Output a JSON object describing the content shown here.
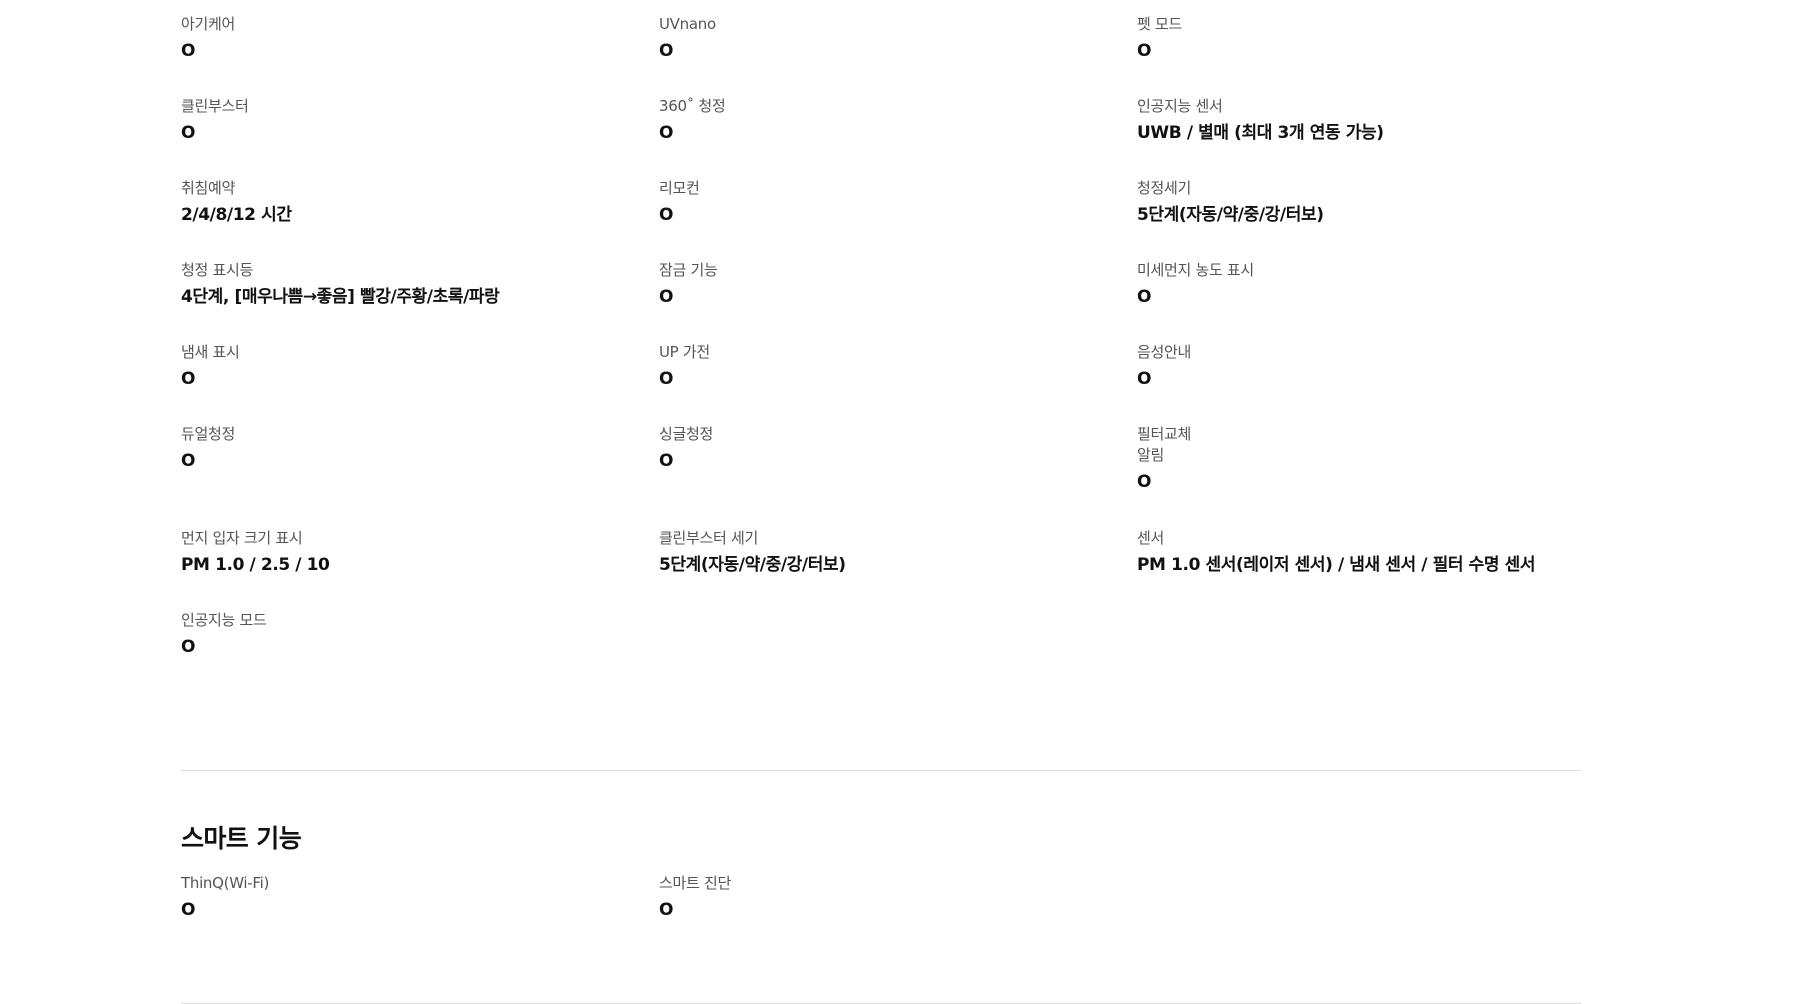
{
  "specs": [
    {
      "label": "아기케어",
      "value": "O"
    },
    {
      "label": "UVnano",
      "value": "O"
    },
    {
      "label": "펫 모드",
      "value": "O"
    },
    {
      "label": "클린부스터",
      "value": "O"
    },
    {
      "label": "360˚ 청정",
      "value": "O"
    },
    {
      "label": "인공지능 센서",
      "value": "UWB / 별매 (최대 3개 연동 가능)"
    },
    {
      "label": "취침예약",
      "value": "2/4/8/12 시간"
    },
    {
      "label": "리모컨",
      "value": "O"
    },
    {
      "label": "청정세기",
      "value": "5단계(자동/약/중/강/터보)"
    },
    {
      "label": "청정 표시등",
      "value": "4단계, [매우나쁨→좋음] 빨강/주황/초록/파랑"
    },
    {
      "label": "잠금 기능",
      "value": "O"
    },
    {
      "label": "미세먼지 농도 표시",
      "value": "O"
    },
    {
      "label": "냄새 표시",
      "value": "O"
    },
    {
      "label": "UP 가전",
      "value": "O"
    },
    {
      "label": "음성안내",
      "value": "O"
    },
    {
      "label": "듀얼청정",
      "value": "O"
    },
    {
      "label": "싱글청정",
      "value": "O"
    },
    {
      "label": "필터교체\n알림",
      "value": "O"
    },
    {
      "label": "먼지 입자 크기 표시",
      "value": "PM 1.0 / 2.5 / 10"
    },
    {
      "label": "클린부스터 세기",
      "value": "5단계(자동/약/중/강/터보)"
    },
    {
      "label": "센서",
      "value": "PM 1.0 센서(레이저 센서) / 냄새 센서 / 필터 수명 센서"
    },
    {
      "label": "인공지능 모드",
      "value": "O"
    }
  ],
  "smart": {
    "title": "스마트 기능",
    "items": [
      {
        "label": "ThinQ(Wi-Fi)",
        "value": "O"
      },
      {
        "label": "스마트 진단",
        "value": "O"
      }
    ]
  }
}
